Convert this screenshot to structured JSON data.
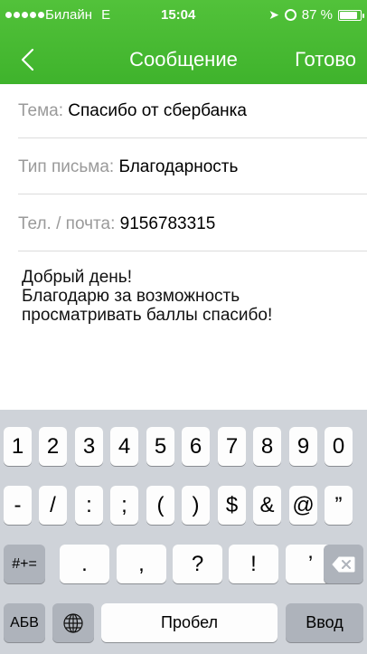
{
  "status_bar": {
    "carrier": "Билайн",
    "network": "E",
    "time": "15:04",
    "battery": "87 %"
  },
  "nav": {
    "back_icon": "chevron-left-icon",
    "title": "Сообщение",
    "done_label": "Готово"
  },
  "form": {
    "subject": {
      "label": "Тема:",
      "value": "Спасибо от сбербанка"
    },
    "type": {
      "label": "Тип письма:",
      "value": "Благодарность"
    },
    "contact": {
      "label": "Тел. / почта:",
      "value": "9156783315"
    }
  },
  "message_lines": [
    "Добрый день!",
    "Благодарю за возможность",
    "просматривать баллы спасибо!"
  ],
  "keyboard": {
    "row1": [
      "1",
      "2",
      "3",
      "4",
      "5",
      "6",
      "7",
      "8",
      "9",
      "0"
    ],
    "row2": [
      "-",
      "/",
      ":",
      ";",
      "(",
      ")",
      "$",
      "&",
      "@",
      "”"
    ],
    "row3_symbols": "#+=",
    "row3": [
      ".",
      ",",
      "?",
      "!",
      "’"
    ],
    "backspace_icon": "backspace-icon",
    "lang_label": "АБВ",
    "globe_icon": "globe-icon",
    "space_label": "Пробел",
    "return_label": "Ввод"
  },
  "colors": {
    "header_green": "#45b72f",
    "keyboard_bg": "#cfd3d9",
    "label_gray": "#9a9a9a"
  }
}
